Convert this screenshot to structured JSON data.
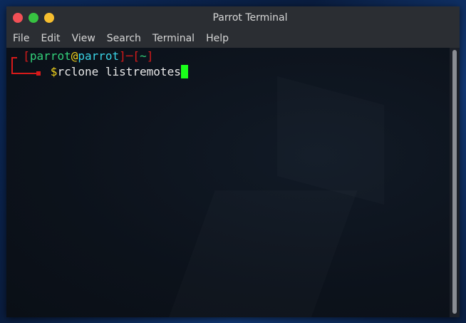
{
  "window": {
    "title": "Parrot Terminal"
  },
  "menubar": {
    "items": [
      "File",
      "Edit",
      "View",
      "Search",
      "Terminal",
      "Help"
    ]
  },
  "terminal": {
    "prompt_open": "[",
    "user": "parrot",
    "at": "@",
    "host": "parrot",
    "prompt_close": "]",
    "dash": "─",
    "dir_open": "[",
    "dir": "~",
    "dir_close": "]",
    "dollar": "$",
    "command": "rclone listremotes"
  },
  "colors": {
    "close": "#f25056",
    "minimize": "#37c241",
    "maximize": "#f6be2f",
    "prompt_red": "#d71a1a",
    "user_green": "#33d17a",
    "host_cyan": "#3ad4e6",
    "dollar_yellow": "#f2d21b",
    "cursor": "#1aff1a"
  }
}
